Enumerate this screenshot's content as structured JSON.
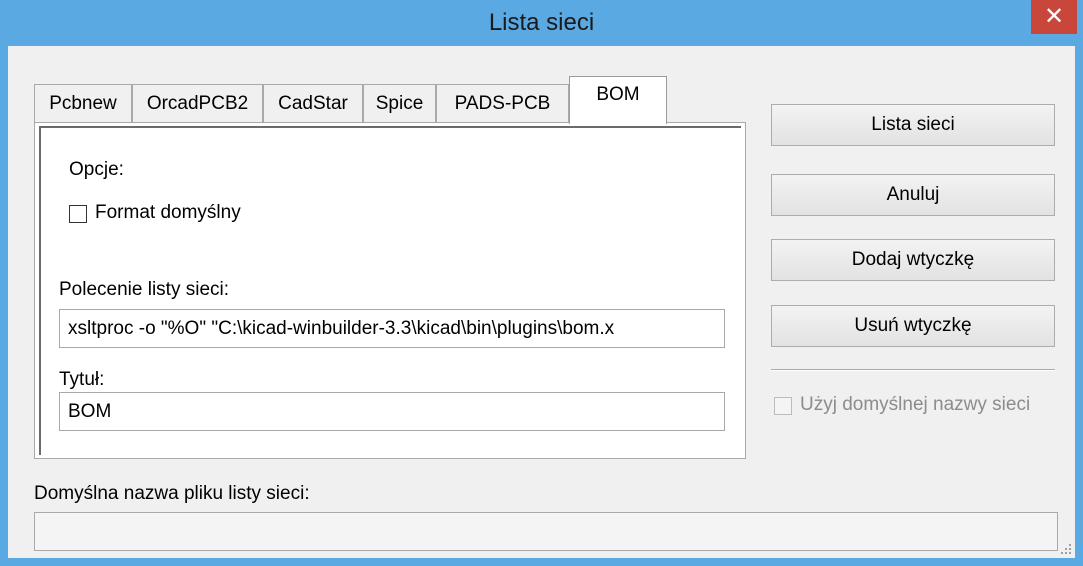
{
  "window": {
    "title": "Lista sieci",
    "close_glyph": "✕"
  },
  "tabs": [
    {
      "label": "Pcbnew"
    },
    {
      "label": "OrcadPCB2"
    },
    {
      "label": "CadStar"
    },
    {
      "label": "Spice"
    },
    {
      "label": "PADS-PCB"
    },
    {
      "label": "BOM",
      "active": true
    }
  ],
  "panel": {
    "options_label": "Opcje:",
    "default_format_label": "Format domyślny",
    "default_format_checked": false,
    "command_label": "Polecenie listy sieci:",
    "command_value": "xsltproc -o \"%O\" \"C:\\kicad-winbuilder-3.3\\kicad\\bin\\plugins\\bom.x",
    "title_label": "Tytuł:",
    "title_value": "BOM"
  },
  "buttons": {
    "netlist": "Lista sieci",
    "cancel": "Anuluj",
    "add_plugin": "Dodaj wtyczkę",
    "remove_plugin": "Usuń wtyczkę"
  },
  "use_default_name": {
    "label": "Użyj domyślnej nazwy sieci",
    "checked": false,
    "enabled": false
  },
  "filename": {
    "label": "Domyślna nazwa pliku listy sieci:",
    "value": ""
  },
  "colors": {
    "title_bar": "#5aa9e2",
    "close_button": "#c8463a",
    "dialog_bg": "#f0f0f0"
  }
}
